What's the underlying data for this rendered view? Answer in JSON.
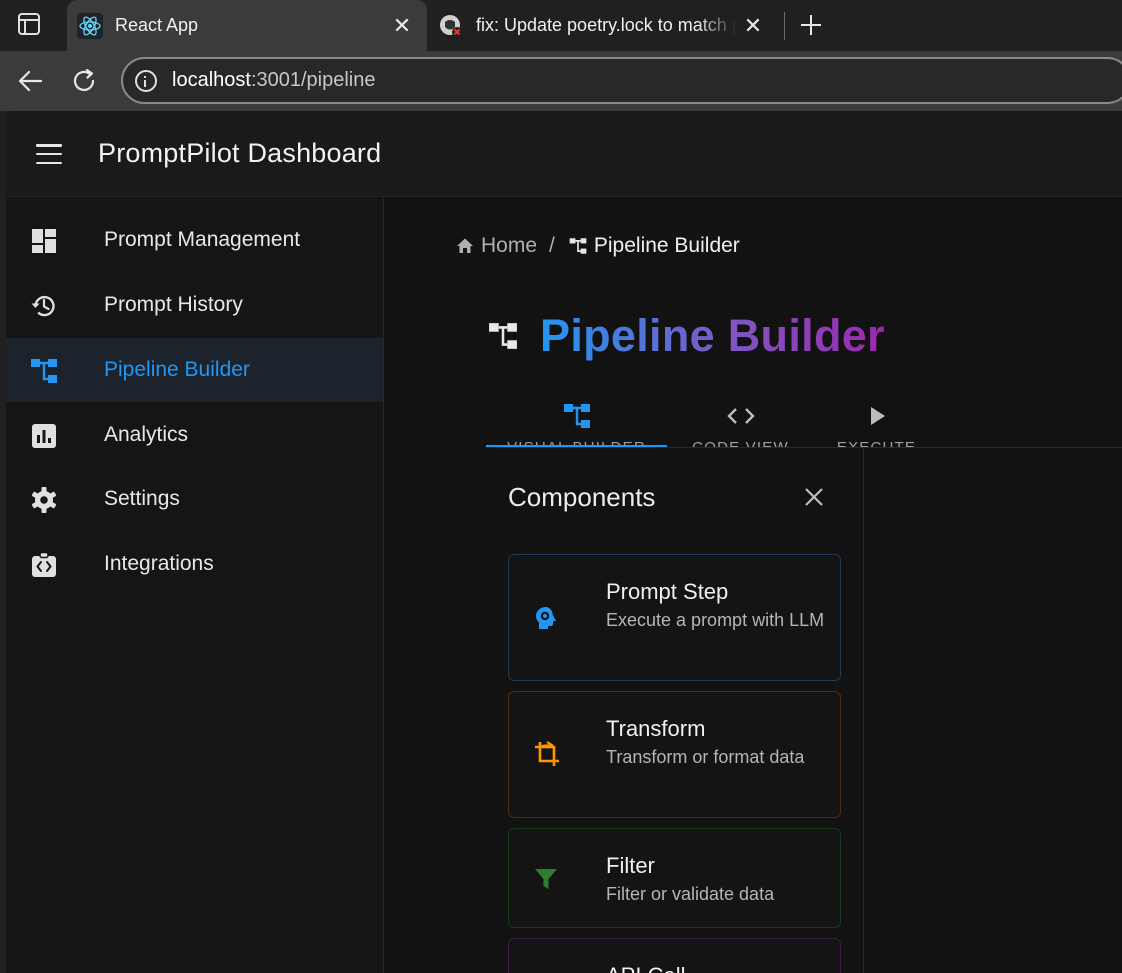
{
  "browser": {
    "tabs": [
      {
        "title": "React App",
        "favicon": "react-icon",
        "active": true
      },
      {
        "title": "fix: Update poetry.lock to match p",
        "favicon": "github-error-icon",
        "active": false
      }
    ],
    "url": {
      "host": "localhost",
      "path": ":3001/pipeline"
    },
    "close_glyph": "✕"
  },
  "app": {
    "title": "PromptPilot Dashboard",
    "accent": "#2196f3",
    "sidebar": {
      "items": [
        {
          "label": "Prompt Management",
          "icon": "dashboard-icon",
          "active": false
        },
        {
          "label": "Prompt History",
          "icon": "history-icon",
          "active": false
        },
        {
          "label": "Pipeline Builder",
          "icon": "account-tree-icon",
          "active": true
        },
        {
          "label": "Analytics",
          "icon": "analytics-icon",
          "active": false
        },
        {
          "label": "Settings",
          "icon": "gear-icon",
          "active": false
        },
        {
          "label": "Integrations",
          "icon": "integration-icon",
          "active": false
        }
      ]
    },
    "breadcrumb": {
      "home": "Home",
      "separator": "/",
      "current": "Pipeline Builder"
    },
    "page_title": "Pipeline Builder",
    "view_tabs": [
      {
        "label": "VISUAL BUILDER",
        "icon": "account-tree-icon",
        "active": true
      },
      {
        "label": "CODE VIEW",
        "icon": "code-icon",
        "active": false
      },
      {
        "label": "EXECUTE",
        "icon": "play-icon",
        "active": false
      }
    ],
    "palette": {
      "title": "Components",
      "items": [
        {
          "title": "Prompt Step",
          "description": "Execute a prompt with LLM",
          "icon": "psychology-icon",
          "color": "#2196f3",
          "border": "#1e3a55"
        },
        {
          "title": "Transform",
          "description": "Transform or format data",
          "icon": "crop-transform-icon",
          "color": "#ff9800",
          "border": "#4a2e14"
        },
        {
          "title": "Filter",
          "description": "Filter or validate data",
          "icon": "filter-icon",
          "color": "#2e7d32",
          "border": "#1b3a1d"
        },
        {
          "title": "API Call",
          "description": "",
          "icon": "api-icon",
          "color": "#9c27b0",
          "border": "#3a1d40"
        }
      ]
    }
  }
}
